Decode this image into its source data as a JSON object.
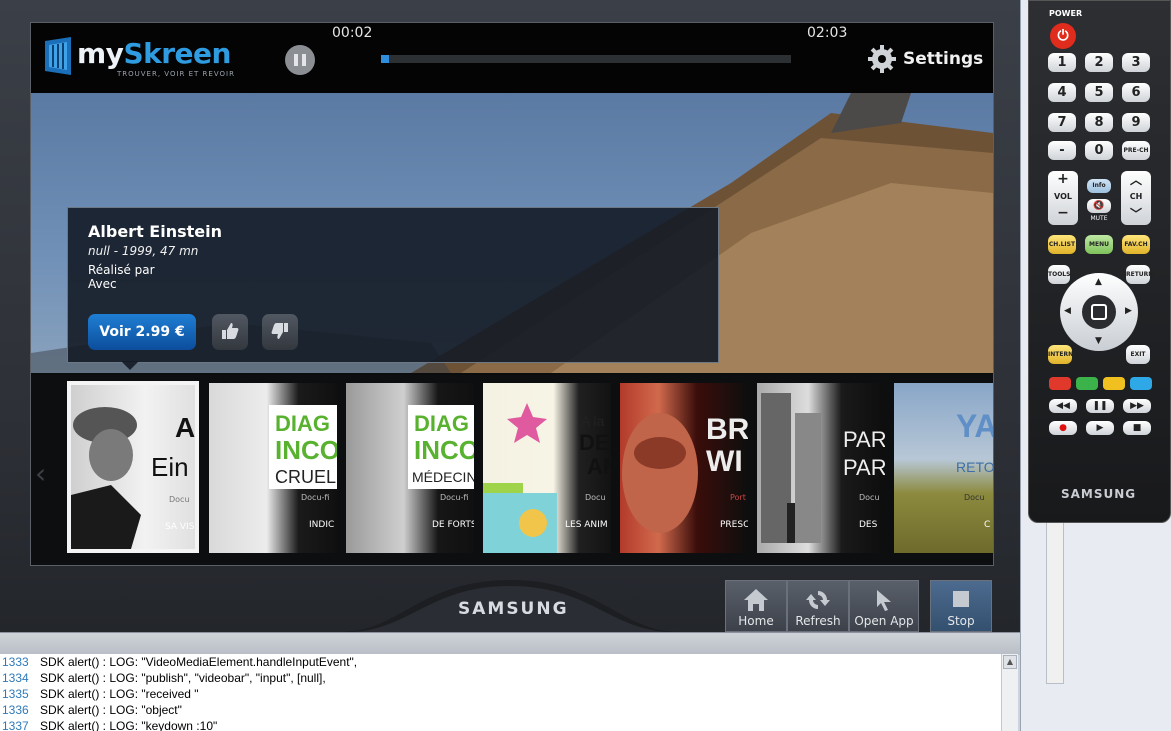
{
  "player": {
    "logo_part1": "my",
    "logo_part2": "Skreen",
    "logo_tagline": "TROUVER, VOIR ET REVOIR",
    "time_elapsed": "00:02",
    "time_total": "02:03",
    "progress_fraction": 0.02,
    "settings_label": "Settings"
  },
  "film": {
    "title": "Albert Einstein",
    "meta": "null  - 1999, 47 mn",
    "director_label": "Réalisé par",
    "cast_label": "Avec",
    "buy_label": "Voir 2.99 €"
  },
  "carousel": {
    "posters": [
      {
        "big": "A",
        "big2": "Ein",
        "small": "Docu",
        "caption": "SA VISI",
        "selected": true
      },
      {
        "big": "DIAG",
        "big2": "INCO",
        "big3": "CRUELL",
        "small": "Docu-fi",
        "caption": "INDIC"
      },
      {
        "big": "DIAG",
        "big2": "INCO",
        "big3": "MÉDECIN",
        "small": "Docu-fi",
        "caption": "DE FORTS"
      },
      {
        "big": "A la",
        "big2": "DES",
        "big3": "AN",
        "small": "Docu",
        "caption": "LES ANIM"
      },
      {
        "big": "BR",
        "big2": "WI",
        "small": "Port",
        "caption": "PRESC"
      },
      {
        "big": "PAR",
        "big2": "PAR",
        "small": "Docu",
        "caption": "DES"
      },
      {
        "big": "YA",
        "big2": "RETOU",
        "small": "Docu",
        "caption": "C"
      }
    ]
  },
  "brand": "SAMSUNG",
  "nav": {
    "home": "Home",
    "refresh": "Refresh",
    "open_app": "Open App",
    "stop": "Stop"
  },
  "remote": {
    "power_label": "POWER",
    "digits": [
      "1",
      "2",
      "3",
      "4",
      "5",
      "6",
      "7",
      "8",
      "9",
      "-",
      "0",
      "PRE-CH"
    ],
    "vol": "VOL",
    "ch": "CH",
    "info": "Info",
    "mute": "MUTE",
    "chlist": "CH.LIST",
    "menu": "MENU",
    "favch": "FAV.CH",
    "tools": "TOOLS",
    "return": "RETURN",
    "internet": "INTERNET",
    "exit": "EXIT",
    "brand": "SAMSUNG"
  },
  "console": {
    "lines": [
      {
        "no": "1333",
        "text": "SDK alert() : LOG: \"VideoMediaElement.handleInputEvent\","
      },
      {
        "no": "1334",
        "text": "SDK alert() : LOG: \"publish\", \"videobar\", \"input\", [null],"
      },
      {
        "no": "1335",
        "text": "SDK alert() : LOG: \"received \""
      },
      {
        "no": "1336",
        "text": "SDK alert() : LOG: \"object\""
      },
      {
        "no": "1337",
        "text": "SDK alert() : LOG: \"keydown :10\""
      }
    ]
  },
  "colors": {
    "accent": "#2f8fde",
    "buy_button": "#1f7fd4",
    "power": "#e02c1c",
    "remote_red": "#e0382a",
    "remote_green": "#3cb34a",
    "remote_yellow": "#f0c020",
    "remote_blue": "#2ea8e6"
  },
  "icons": [
    "pause-icon",
    "gear-icon",
    "thumbs-up-icon",
    "thumbs-down-icon",
    "home-icon",
    "refresh-icon",
    "cursor-icon",
    "stop-icon",
    "power-icon",
    "mute-icon",
    "chevron-left-icon"
  ]
}
